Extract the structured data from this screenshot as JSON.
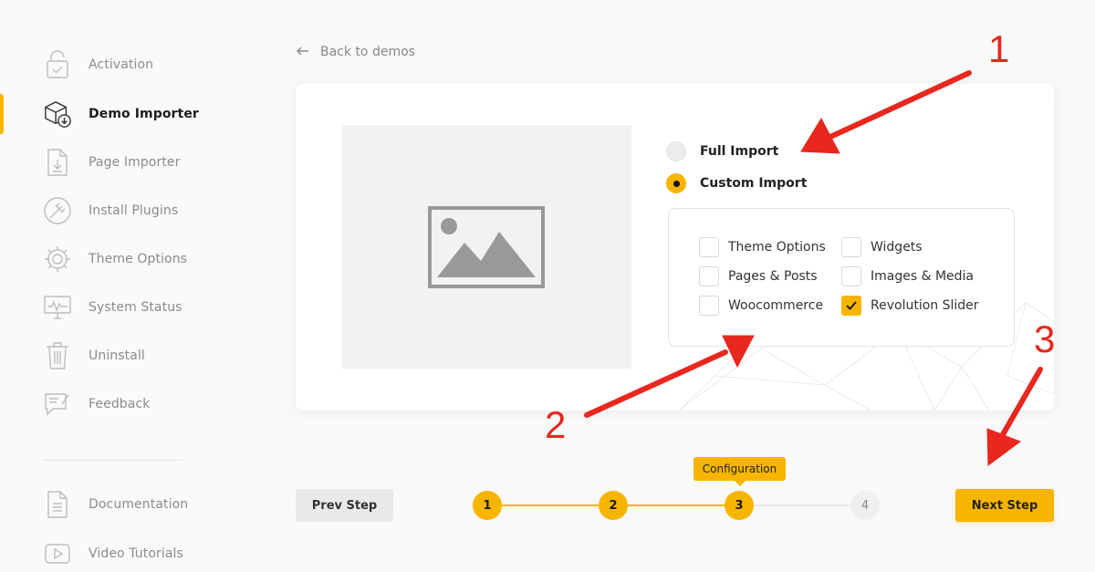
{
  "sidebar": {
    "items": [
      {
        "label": "Activation",
        "icon": "lock-icon"
      },
      {
        "label": "Demo Importer",
        "icon": "box-download-icon"
      },
      {
        "label": "Page Importer",
        "icon": "file-download-icon"
      },
      {
        "label": "Install Plugins",
        "icon": "plug-icon"
      },
      {
        "label": "Theme Options",
        "icon": "gear-icon"
      },
      {
        "label": "System Status",
        "icon": "monitor-icon"
      },
      {
        "label": "Uninstall",
        "icon": "trash-icon"
      },
      {
        "label": "Feedback",
        "icon": "feedback-icon"
      },
      {
        "label": "Documentation",
        "icon": "document-icon"
      },
      {
        "label": "Video Tutorials",
        "icon": "video-play-icon"
      }
    ],
    "active": "Demo Importer"
  },
  "main": {
    "back_label": "Back to demos",
    "import_modes": [
      {
        "label": "Full Import",
        "selected": false
      },
      {
        "label": "Custom Import",
        "selected": true
      }
    ],
    "options": [
      {
        "label": "Theme Options",
        "checked": false
      },
      {
        "label": "Widgets",
        "checked": false
      },
      {
        "label": "Pages & Posts",
        "checked": false
      },
      {
        "label": "Images & Media",
        "checked": false
      },
      {
        "label": "Woocommerce",
        "checked": false
      },
      {
        "label": "Revolution Slider",
        "checked": true
      }
    ]
  },
  "wizard": {
    "prev_label": "Prev Step",
    "next_label": "Next Step",
    "tooltip": "Configuration",
    "steps": [
      "1",
      "2",
      "3",
      "4"
    ],
    "current_step": 3
  },
  "annotations": [
    "1",
    "2",
    "3"
  ],
  "colors": {
    "accent": "#f7b500",
    "arrow": "#e8271e"
  }
}
